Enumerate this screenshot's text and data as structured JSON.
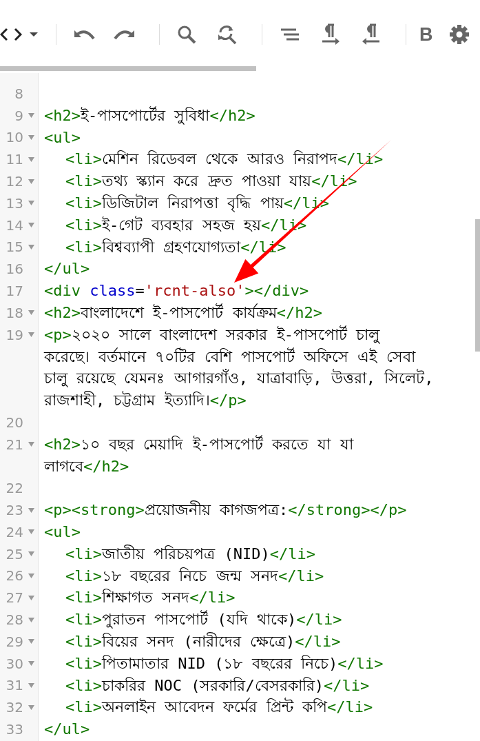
{
  "toolbar": {
    "bold_label": "B"
  },
  "lines": [
    {
      "number": "8",
      "foldable": false,
      "indented": false
    },
    {
      "number": "9",
      "foldable": true,
      "indented": false,
      "rows": [
        [
          {
            "kind": "tag",
            "text": "<h2>"
          },
          {
            "kind": "text",
            "text": "ই-পাসপোর্টের সুবিধা"
          },
          {
            "kind": "tag",
            "text": "</h2>"
          }
        ]
      ]
    },
    {
      "number": "10",
      "foldable": true,
      "indented": false,
      "rows": [
        [
          {
            "kind": "tag",
            "text": "<ul>"
          }
        ]
      ]
    },
    {
      "number": "11",
      "foldable": true,
      "indented": true,
      "rows": [
        [
          {
            "kind": "tag",
            "text": "<li>"
          },
          {
            "kind": "text",
            "text": "মেশিন রিডেবল থেকে আরও নিরাপদ"
          },
          {
            "kind": "tag",
            "text": "</li>"
          }
        ]
      ]
    },
    {
      "number": "12",
      "foldable": true,
      "indented": true,
      "rows": [
        [
          {
            "kind": "tag",
            "text": "<li>"
          },
          {
            "kind": "text",
            "text": "তথ্য স্ক্যান করে দ্রুত পাওয়া যায়"
          },
          {
            "kind": "tag",
            "text": "</li>"
          }
        ]
      ]
    },
    {
      "number": "13",
      "foldable": true,
      "indented": true,
      "rows": [
        [
          {
            "kind": "tag",
            "text": "<li>"
          },
          {
            "kind": "text",
            "text": "ডিজিটাল নিরাপত্তা বৃদ্ধি পায়"
          },
          {
            "kind": "tag",
            "text": "</li>"
          }
        ]
      ]
    },
    {
      "number": "14",
      "foldable": true,
      "indented": true,
      "rows": [
        [
          {
            "kind": "tag",
            "text": "<li>"
          },
          {
            "kind": "text",
            "text": "ই-গেট ব্যবহার সহজ হয়"
          },
          {
            "kind": "tag",
            "text": "</li>"
          }
        ]
      ]
    },
    {
      "number": "15",
      "foldable": true,
      "indented": true,
      "rows": [
        [
          {
            "kind": "tag",
            "text": "<li>"
          },
          {
            "kind": "text",
            "text": "বিশ্বব্যাপী গ্রহণযোগ্যতা"
          },
          {
            "kind": "tag",
            "text": "</li>"
          }
        ]
      ]
    },
    {
      "number": "16",
      "foldable": false,
      "indented": false,
      "rows": [
        [
          {
            "kind": "tag",
            "text": "</ul>"
          }
        ]
      ]
    },
    {
      "number": "17",
      "foldable": false,
      "indented": false,
      "rows": [
        [
          {
            "kind": "tag",
            "text": "<div "
          },
          {
            "kind": "attr",
            "text": "class"
          },
          {
            "kind": "punct",
            "text": "="
          },
          {
            "kind": "string",
            "text": "'rcnt-also'"
          },
          {
            "kind": "tag",
            "text": "></div>"
          }
        ]
      ]
    },
    {
      "number": "18",
      "foldable": true,
      "indented": false,
      "rows": [
        [
          {
            "kind": "tag",
            "text": "<h2>"
          },
          {
            "kind": "text",
            "text": "বাংলাদেশে ই-পাসপোর্ট কার্যক্রম"
          },
          {
            "kind": "tag",
            "text": "</h2>"
          }
        ]
      ]
    },
    {
      "number": "19",
      "foldable": true,
      "indented": false,
      "rows": [
        [
          {
            "kind": "tag",
            "text": "<p>"
          },
          {
            "kind": "text",
            "text": "২০২০ সালে বাংলাদেশ সরকার ই-পাসপোর্ট চালু"
          }
        ],
        [
          {
            "kind": "text",
            "text": "করেছে। বর্তমানে ৭০টির বেশি পাসপোর্ট অফিসে এই সেবা"
          }
        ],
        [
          {
            "kind": "text",
            "text": "চালু রয়েছে যেমনঃ আগারগাঁও, যাত্রাবাড়ি, উত্তরা, সিলেট,"
          }
        ],
        [
          {
            "kind": "text",
            "text": "রাজশাহী, চট্টগ্রাম ইত্যাদি।"
          },
          {
            "kind": "tag",
            "text": "</p>"
          }
        ]
      ]
    },
    {
      "number": "20",
      "foldable": false,
      "indented": false
    },
    {
      "number": "21",
      "foldable": true,
      "indented": false,
      "rows": [
        [
          {
            "kind": "tag",
            "text": "<h2>"
          },
          {
            "kind": "text",
            "text": "১০ বছর মেয়াদি ই-পাসপোর্ট করতে যা যা"
          }
        ],
        [
          {
            "kind": "text",
            "text": "লাগবে"
          },
          {
            "kind": "tag",
            "text": "</h2>"
          }
        ]
      ]
    },
    {
      "number": "22",
      "foldable": false,
      "indented": false
    },
    {
      "number": "23",
      "foldable": true,
      "indented": false,
      "rows": [
        [
          {
            "kind": "tag",
            "text": "<p><strong>"
          },
          {
            "kind": "text",
            "text": "প্রয়োজনীয় কাগজপত্র:"
          },
          {
            "kind": "tag",
            "text": "</strong></p>"
          }
        ]
      ]
    },
    {
      "number": "24",
      "foldable": true,
      "indented": false,
      "rows": [
        [
          {
            "kind": "tag",
            "text": "<ul>"
          }
        ]
      ]
    },
    {
      "number": "25",
      "foldable": true,
      "indented": true,
      "rows": [
        [
          {
            "kind": "tag",
            "text": "<li>"
          },
          {
            "kind": "text",
            "text": "জাতীয় পরিচয়পত্র (NID)"
          },
          {
            "kind": "tag",
            "text": "</li>"
          }
        ]
      ]
    },
    {
      "number": "26",
      "foldable": true,
      "indented": true,
      "rows": [
        [
          {
            "kind": "tag",
            "text": "<li>"
          },
          {
            "kind": "text",
            "text": "১৮ বছরের নিচে জন্ম সনদ"
          },
          {
            "kind": "tag",
            "text": "</li>"
          }
        ]
      ]
    },
    {
      "number": "27",
      "foldable": true,
      "indented": true,
      "rows": [
        [
          {
            "kind": "tag",
            "text": "<li>"
          },
          {
            "kind": "text",
            "text": "শিক্ষাগত সনদ"
          },
          {
            "kind": "tag",
            "text": "</li>"
          }
        ]
      ]
    },
    {
      "number": "28",
      "foldable": true,
      "indented": true,
      "rows": [
        [
          {
            "kind": "tag",
            "text": "<li>"
          },
          {
            "kind": "text",
            "text": "পুরাতন পাসপোর্ট (যদি থাকে)"
          },
          {
            "kind": "tag",
            "text": "</li>"
          }
        ]
      ]
    },
    {
      "number": "29",
      "foldable": true,
      "indented": true,
      "rows": [
        [
          {
            "kind": "tag",
            "text": "<li>"
          },
          {
            "kind": "text",
            "text": "বিয়ের সনদ (নারীদের ক্ষেত্রে)"
          },
          {
            "kind": "tag",
            "text": "</li>"
          }
        ]
      ]
    },
    {
      "number": "30",
      "foldable": true,
      "indented": true,
      "rows": [
        [
          {
            "kind": "tag",
            "text": "<li>"
          },
          {
            "kind": "text",
            "text": "পিতামাতার NID (১৮ বছরের নিচে)"
          },
          {
            "kind": "tag",
            "text": "</li>"
          }
        ]
      ]
    },
    {
      "number": "31",
      "foldable": true,
      "indented": true,
      "rows": [
        [
          {
            "kind": "tag",
            "text": "<li>"
          },
          {
            "kind": "text",
            "text": "চাকরির NOC (সরকারি/বেসরকারি)"
          },
          {
            "kind": "tag",
            "text": "</li>"
          }
        ]
      ]
    },
    {
      "number": "32",
      "foldable": true,
      "indented": true,
      "rows": [
        [
          {
            "kind": "tag",
            "text": "<li>"
          },
          {
            "kind": "text",
            "text": "অনলাইন আবেদন ফর্মের প্রিন্ট কপি"
          },
          {
            "kind": "tag",
            "text": "</li>"
          }
        ]
      ]
    },
    {
      "number": "33",
      "foldable": false,
      "indented": false,
      "rows": [
        [
          {
            "kind": "tag",
            "text": "</ul>"
          }
        ]
      ]
    }
  ]
}
